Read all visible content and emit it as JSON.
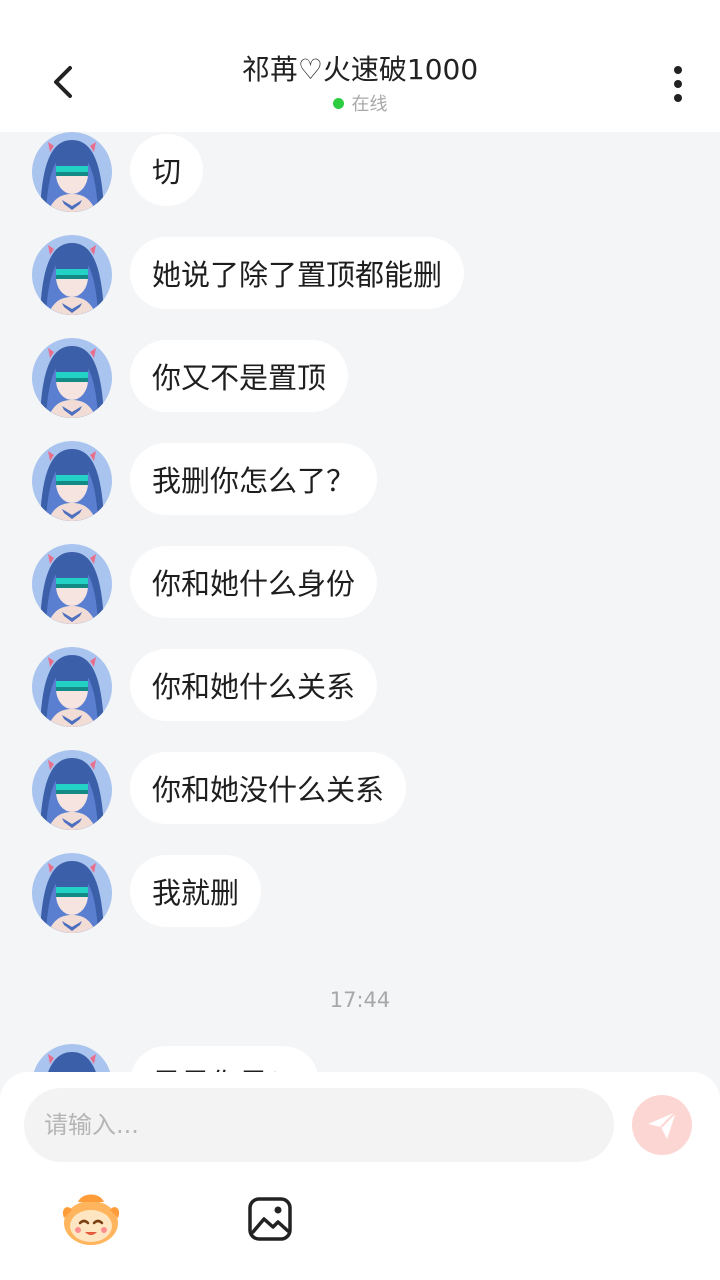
{
  "header": {
    "title": "祁苒♡火速破1000",
    "status": "在线",
    "status_color": "#2ecc40",
    "back_icon": "chevron-left-icon",
    "more_icon": "more-vertical-icon"
  },
  "messages": [
    {
      "text": "切"
    },
    {
      "text": "她说了除了置顶都能删"
    },
    {
      "text": "你又不是置顶"
    },
    {
      "text": "我删你怎么了？"
    },
    {
      "text": "你和她什么身份"
    },
    {
      "text": "你和她什么关系"
    },
    {
      "text": "你和她没什么关系"
    },
    {
      "text": "我就删"
    },
    {
      "text": "是是你是？"
    }
  ],
  "timestamp": "17:44",
  "input": {
    "placeholder": "请输入...",
    "value": ""
  },
  "toolbar": {
    "emoji_icon": "emoji-face-icon",
    "image_icon": "image-icon",
    "send_icon": "send-icon",
    "send_color": "#fcd6d3"
  }
}
